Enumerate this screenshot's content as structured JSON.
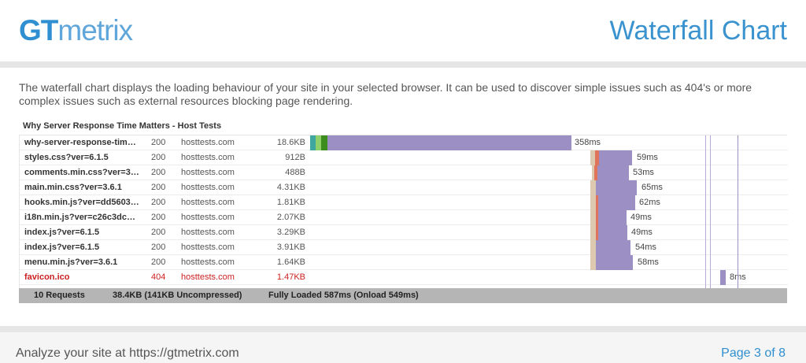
{
  "header": {
    "logo_gt": "GT",
    "logo_metrix": "metrix",
    "title": "Waterfall Chart"
  },
  "intro": "The waterfall chart displays the loading behaviour of your site in your selected browser. It can be used to discover simple issues such as 404's or more complex issues such as external resources blocking page rendering.",
  "waterfall": {
    "title": "Why Server Response Time Matters - Host Tests",
    "rows": [
      {
        "url": "why-server-response-tim…",
        "status": "200",
        "domain": "hosttests.com",
        "size": "18.6KB",
        "time": "358ms",
        "error": false
      },
      {
        "url": "styles.css?ver=6.1.5",
        "status": "200",
        "domain": "hosttests.com",
        "size": "912B",
        "time": "59ms",
        "error": false
      },
      {
        "url": "comments.min.css?ver=3…",
        "status": "200",
        "domain": "hosttests.com",
        "size": "488B",
        "time": "53ms",
        "error": false
      },
      {
        "url": "main.min.css?ver=3.6.1",
        "status": "200",
        "domain": "hosttests.com",
        "size": "4.31KB",
        "time": "65ms",
        "error": false
      },
      {
        "url": "hooks.min.js?ver=dd5603…",
        "status": "200",
        "domain": "hosttests.com",
        "size": "1.81KB",
        "time": "62ms",
        "error": false
      },
      {
        "url": "i18n.min.js?ver=c26c3dc…",
        "status": "200",
        "domain": "hosttests.com",
        "size": "2.07KB",
        "time": "49ms",
        "error": false
      },
      {
        "url": "index.js?ver=6.1.5",
        "status": "200",
        "domain": "hosttests.com",
        "size": "3.29KB",
        "time": "49ms",
        "error": false
      },
      {
        "url": "index.js?ver=6.1.5",
        "status": "200",
        "domain": "hosttests.com",
        "size": "3.91KB",
        "time": "54ms",
        "error": false
      },
      {
        "url": "menu.min.js?ver=3.6.1",
        "status": "200",
        "domain": "hosttests.com",
        "size": "1.64KB",
        "time": "58ms",
        "error": false
      },
      {
        "url": "favicon.ico",
        "status": "404",
        "domain": "hosttests.com",
        "size": "1.47KB",
        "time": "8ms",
        "error": true
      }
    ],
    "summary": {
      "requests": "10 Requests",
      "size": "38.4KB  (141KB Uncompressed)",
      "loaded": "Fully Loaded 587ms  (Onload 549ms)"
    }
  },
  "colors": {
    "receive": "#9b8fc4",
    "wait": "#e0745a",
    "blocked": "#dcc9b0",
    "dns": "#3fa7a0",
    "connect": "#8fd06a",
    "ssl": "#3d8c1e",
    "onload_line": "#b9a9d8",
    "fully_loaded_line": "#d9a8c8"
  },
  "footer": {
    "left": "Analyze your site at https://gtmetrix.com",
    "right": "Page 3 of 8"
  }
}
